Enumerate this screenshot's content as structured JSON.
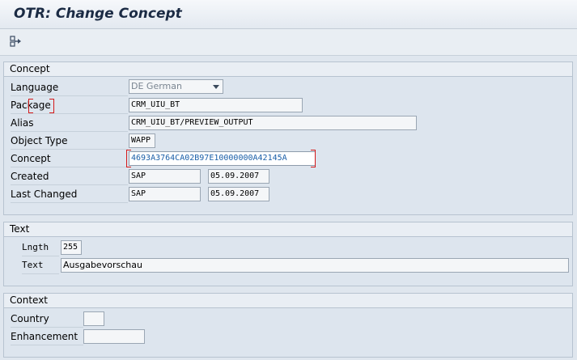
{
  "window": {
    "title": "OTR: Change Concept"
  },
  "toolbar": {
    "icon": "navigate-icon"
  },
  "concept": {
    "header": "Concept",
    "language": {
      "label": "Language",
      "value": "DE German"
    },
    "package": {
      "label": "Package",
      "value": "CRM_UIU_BT"
    },
    "alias": {
      "label": "Alias",
      "value": "CRM_UIU_BT/PREVIEW_OUTPUT"
    },
    "object_type": {
      "label": "Object Type",
      "value": "WAPP"
    },
    "concept_id": {
      "label": "Concept",
      "value": "4693A3764CA02B97E10000000A42145A"
    },
    "created": {
      "label": "Created",
      "user": "SAP",
      "date": "05.09.2007"
    },
    "last_changed": {
      "label": "Last Changed",
      "user": "SAP",
      "date": "05.09.2007"
    }
  },
  "text": {
    "header": "Text",
    "length": {
      "label": "Lngth",
      "value": "255"
    },
    "text": {
      "label": "Text",
      "value": "Ausgabevorschau"
    }
  },
  "context": {
    "header": "Context",
    "country": {
      "label": "Country",
      "value": ""
    },
    "enhancement": {
      "label": "Enhancement",
      "value": ""
    }
  },
  "colors": {
    "focus_marker": "#d41919",
    "concept_value": "#1a5fa8"
  }
}
